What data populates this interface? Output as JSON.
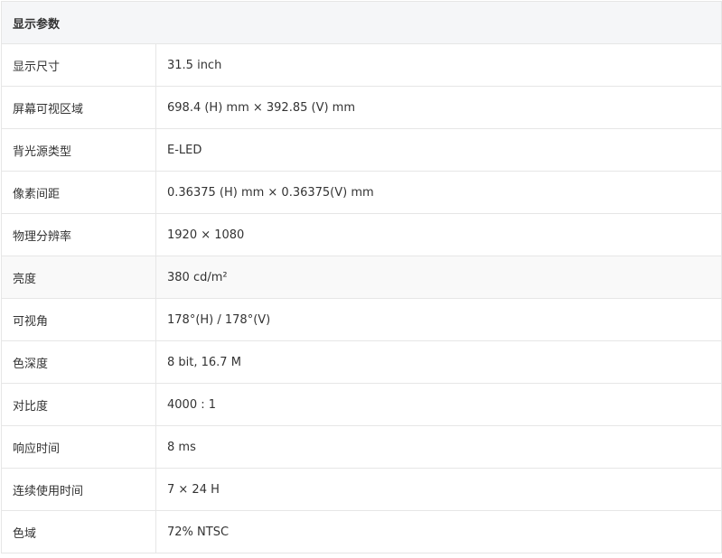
{
  "section_title": "显示参数",
  "rows": [
    {
      "label": "显示尺寸",
      "value": "31.5 inch"
    },
    {
      "label": "屏幕可视区域",
      "value": "698.4 (H) mm × 392.85 (V) mm"
    },
    {
      "label": "背光源类型",
      "value": "E-LED"
    },
    {
      "label": "像素间距",
      "value": "0.36375 (H) mm × 0.36375(V) mm"
    },
    {
      "label": "物理分辨率",
      "value": "1920 × 1080"
    },
    {
      "label": "亮度",
      "value": "380 cd/m²"
    },
    {
      "label": "可视角",
      "value": "178°(H) / 178°(V)"
    },
    {
      "label": "色深度",
      "value": "8 bit, 16.7 M"
    },
    {
      "label": "对比度",
      "value": "4000 : 1"
    },
    {
      "label": "响应时间",
      "value": "8 ms"
    },
    {
      "label": "连续使用时间",
      "value": "7 × 24 H"
    },
    {
      "label": "色域",
      "value": "72% NTSC"
    }
  ]
}
